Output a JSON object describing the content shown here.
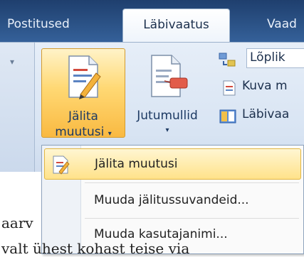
{
  "tabs": {
    "mailings": "Postitused",
    "review": "Läbivaatus",
    "view": "Vaad"
  },
  "ribbon": {
    "track_changes": {
      "line1": "Jälita",
      "line2": "muutusi",
      "arrow": "▾"
    },
    "balloons": {
      "label": "Jutumullid",
      "arrow": "▾"
    },
    "display_for_review": {
      "value": "Lõplik"
    },
    "show_markup": {
      "label": "Kuva m"
    },
    "reviewing_pane": {
      "label": "Läbivaa"
    }
  },
  "menu": {
    "items": [
      {
        "label": "Jälita muutusi",
        "highlighted": true
      },
      {
        "label": "Muuda jälitussuvandeid..."
      },
      {
        "label": "Muuda kasutajanimi..."
      }
    ]
  },
  "document": {
    "line1": "aarv",
    "line2": "valt ühest kohast teise via"
  },
  "colors": {
    "tab_strip": "#2b5286",
    "ribbon": "#dce6f4",
    "highlight": "#ffd873",
    "menu_highlight": "#ffe28a"
  }
}
